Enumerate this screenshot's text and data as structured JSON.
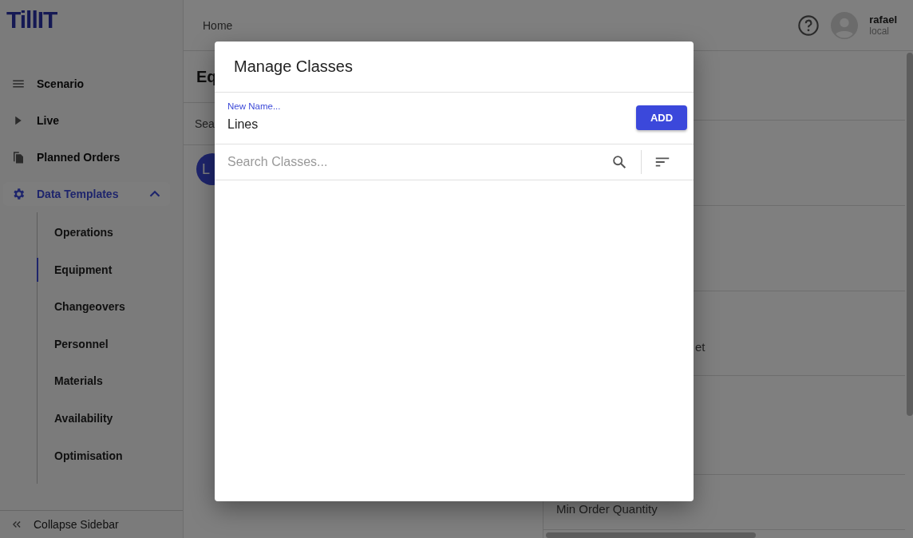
{
  "sidebar": {
    "logo": "TillIT",
    "items": [
      {
        "label": "Scenario",
        "selected": false
      },
      {
        "label": "Live",
        "selected": false
      },
      {
        "label": "Planned Orders",
        "selected": false
      },
      {
        "label": "Data Templates",
        "selected": true,
        "expanded": true,
        "children": [
          {
            "label": "Operations",
            "selected": false
          },
          {
            "label": "Equipment",
            "selected": true
          },
          {
            "label": "Changeovers",
            "selected": false
          },
          {
            "label": "Personnel",
            "selected": false
          },
          {
            "label": "Materials",
            "selected": false
          },
          {
            "label": "Availability",
            "selected": false
          },
          {
            "label": "Optimisation",
            "selected": false
          }
        ]
      }
    ],
    "collapse": "Collapse Sidebar"
  },
  "header": {
    "breadcrumb": "Home",
    "user": {
      "name": "rafael",
      "realm": "local"
    }
  },
  "list_panel": {
    "title": "Eq",
    "search_placeholder": "Sea",
    "avatar": "L"
  },
  "detail_panel": {
    "texts": [
      "et",
      "Min Order Quantity"
    ]
  },
  "dialog": {
    "title": "Manage Classes",
    "new_name": {
      "label": "New Name...",
      "value": "Lines"
    },
    "add_button": "ADD",
    "search": {
      "placeholder": "Search Classes..."
    }
  }
}
